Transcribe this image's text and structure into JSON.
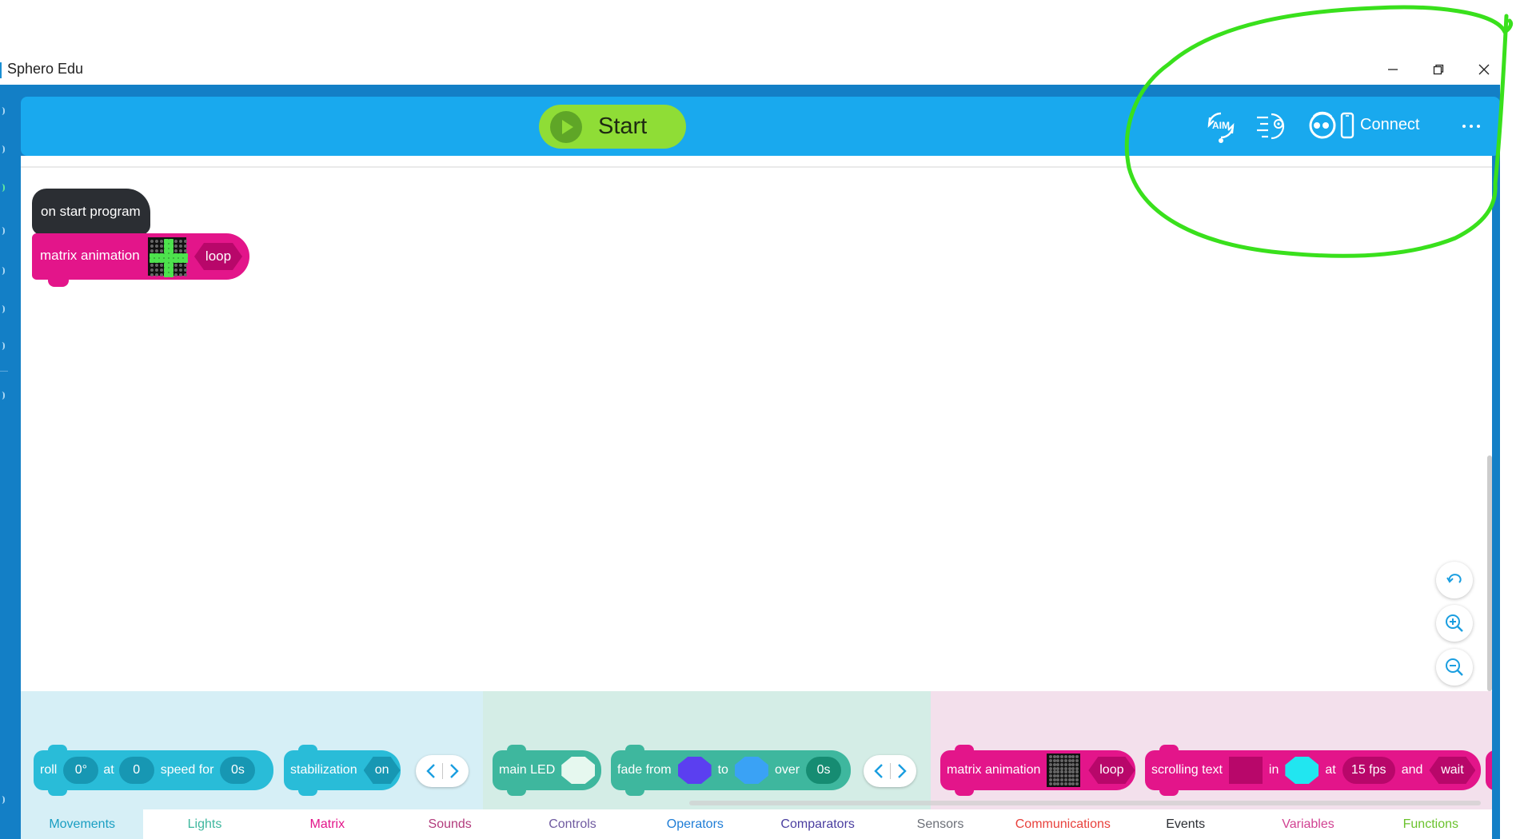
{
  "window": {
    "title": "Sphero Edu"
  },
  "toolbar": {
    "start_label": "Start",
    "aim_label": "AIM",
    "connect_label": "Connect"
  },
  "canvas": {
    "hat_block_label": "on start program",
    "matrix_block_label": "matrix animation",
    "matrix_loop_label": "loop"
  },
  "palette": {
    "roll": {
      "label": "roll",
      "heading": "0°",
      "at": "at",
      "speed": "0",
      "speed_for": "speed for",
      "duration": "0s"
    },
    "stabilization": {
      "label": "stabilization",
      "value": "on"
    },
    "main_led": {
      "label": "main LED"
    },
    "fade": {
      "from_label": "fade from",
      "to_label": "to",
      "over_label": "over",
      "duration": "0s"
    },
    "matrix_animation": {
      "label": "matrix animation",
      "mode": "loop"
    },
    "scrolling_text": {
      "label": "scrolling text",
      "in": "in",
      "at": "at",
      "fps": "15 fps",
      "and": "and",
      "wait": "wait"
    }
  },
  "categories": [
    {
      "label": "Movements",
      "color": "#1a9ec2"
    },
    {
      "label": "Lights",
      "color": "#3eb79e"
    },
    {
      "label": "Matrix",
      "color": "#e3158a"
    },
    {
      "label": "Sounds",
      "color": "#b23b7c"
    },
    {
      "label": "Controls",
      "color": "#6f5aa0"
    },
    {
      "label": "Operators",
      "color": "#1e7dd6"
    },
    {
      "label": "Comparators",
      "color": "#4a3ea0"
    },
    {
      "label": "Sensors",
      "color": "#6c7078"
    },
    {
      "label": "Communications",
      "color": "#e8413c"
    },
    {
      "label": "Events",
      "color": "#2b2e33"
    },
    {
      "label": "Variables",
      "color": "#d14292"
    },
    {
      "label": "Functions",
      "color": "#6ac22c"
    }
  ],
  "colors": {
    "frame_blue": "#137fc6",
    "toolbar_blue": "#19a9ee",
    "start_green": "#8fdd36",
    "matrix_pink": "#e3158a",
    "annotation_green": "#39e01c",
    "fade_from_color": "#5b3ff0",
    "fade_to_color": "#3aa2f5",
    "led_color": "#e6f8ef",
    "scroll_text_color": "#b8076a",
    "scroll_bg_color": "#21e6f0"
  },
  "icons": [
    "minimize-icon",
    "restore-icon",
    "close-icon",
    "play-icon",
    "aim-icon",
    "drive-icon",
    "robot-icon",
    "phone-icon",
    "more-icon",
    "undo-icon",
    "zoom-in-icon",
    "zoom-out-icon",
    "chevron-left-icon",
    "chevron-right-icon"
  ]
}
